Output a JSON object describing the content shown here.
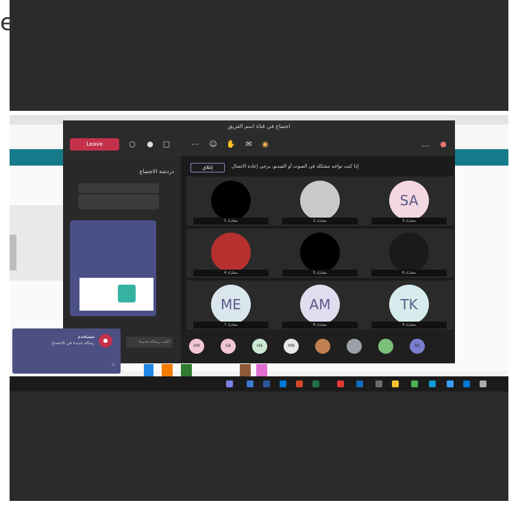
{
  "left_edge_text": "e",
  "teams": {
    "window_title": "اجتماع في قناة اسم الفريق",
    "leave_label": "Leave",
    "chat_title": "دردشة الاجتماع",
    "chat_compose_placeholder": "اكتب رسالة جديدة",
    "banner_text": "إذا كنت تواجه مشكلة في الصوت أو الفيديو، يرجى إعادة الاتصال",
    "banner_button": "إغلاق",
    "tiles": [
      {
        "initials": "",
        "name": "مشارك 1",
        "bg": "#000000"
      },
      {
        "initials": "",
        "name": "مشارك 2",
        "bg": "#c9c9c9"
      },
      {
        "initials": "SA",
        "name": "مشارك 3",
        "bg": "#f3d7e1"
      },
      {
        "initials": "",
        "name": "مشارك 4",
        "bg": "#b73030"
      },
      {
        "initials": "",
        "name": "مشارك 5",
        "bg": "#000000"
      },
      {
        "initials": "",
        "name": "مشارك 6",
        "bg": "#1a1a1a"
      },
      {
        "initials": "ME",
        "name": "مشارك 7",
        "bg": "#d9e6ec"
      },
      {
        "initials": "AM",
        "name": "مشارك 8",
        "bg": "#e2dcef"
      },
      {
        "initials": "TK",
        "name": "مشارك 9",
        "bg": "#d6ecec"
      }
    ],
    "gallery": [
      {
        "label": "AM",
        "bg": "#f3c6d6"
      },
      {
        "label": "SA",
        "bg": "#f3c6d6"
      },
      {
        "label": "HA",
        "bg": "#cde8d4"
      },
      {
        "label": "MN",
        "bg": "#e8e8e8"
      },
      {
        "label": "",
        "bg": "#c08050"
      },
      {
        "label": "",
        "bg": "#9aa0a6"
      },
      {
        "label": "",
        "bg": "#7cc07c"
      },
      {
        "label": "BS",
        "bg": "#7a7fd0"
      }
    ]
  },
  "toast": {
    "name": "مستخدم",
    "message": "رسالة جديدة في الاجتماع",
    "reply": "رد"
  },
  "colors": {
    "teams_purple": "#4b4f82",
    "leave_red": "#c4314b",
    "browser_teal": "#157a8a",
    "taskbar": "#1b1b1b"
  }
}
